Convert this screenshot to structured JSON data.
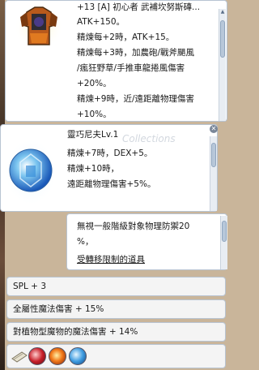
{
  "item_window": {
    "title": "+13 [A] 初心者 武補坎努斯磚...",
    "lines": [
      "ATK+150。",
      "精煉每+2時，ATK+15。",
      "精煉每+3時，加農砲/戰斧颶風",
      "/瘋狂野草/手推車龍捲風傷害",
      "+20%。",
      "精煉+9時，近/遠距離物理傷害",
      "+10%。"
    ]
  },
  "card_window": {
    "title": "靈巧尼夫Lv.1",
    "watermark": "Collections",
    "lines": [
      "精煉+7時，DEX+5。",
      "精煉+10時，",
      "遠距離物理傷害+5%。"
    ]
  },
  "desc_window": {
    "lines": [
      "無視一般階級對象物理防禦20",
      "%，"
    ],
    "link": "受轉移限制的道具"
  },
  "options": [
    "SPL + 3",
    "全屬性魔法傷害 + 15%",
    "對植物型魔物的魔法傷害 + 14%"
  ],
  "colors": {
    "panel_border": "#b8c4d2",
    "scroll_thumb": "#b7c7d9",
    "background": "#c9b59a"
  },
  "icons": [
    "armor-image",
    "blue-gem-card-image",
    "scroll-icon",
    "red-orb-icon",
    "fire-orb-icon",
    "blue-crystal-icon"
  ]
}
